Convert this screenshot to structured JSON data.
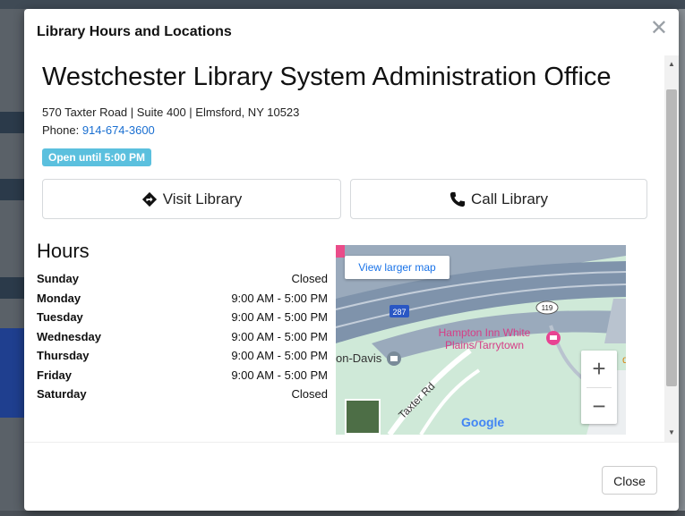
{
  "modal": {
    "title": "Library Hours and Locations",
    "close_icon": "close-icon",
    "office_name": "Westchester Library System Administration Office",
    "address": "570 Taxter Road | Suite 400 | Elmsford, NY 10523",
    "phone_label": "Phone:",
    "phone_number": "914-674-3600",
    "status_badge": "Open until 5:00 PM",
    "visit_label": "Visit Library",
    "visit_icon": "directions-icon",
    "call_label": "Call Library",
    "call_icon": "phone-icon",
    "hours_heading": "Hours",
    "hours": [
      {
        "day": "Sunday",
        "time": "Closed"
      },
      {
        "day": "Monday",
        "time": "9:00 AM - 5:00 PM"
      },
      {
        "day": "Tuesday",
        "time": "9:00 AM - 5:00 PM"
      },
      {
        "day": "Wednesday",
        "time": "9:00 AM - 5:00 PM"
      },
      {
        "day": "Thursday",
        "time": "9:00 AM - 5:00 PM"
      },
      {
        "day": "Friday",
        "time": "9:00 AM - 5:00 PM"
      },
      {
        "day": "Saturday",
        "time": "Closed"
      }
    ],
    "footer_close": "Close"
  },
  "map": {
    "view_larger": "View larger map",
    "label_hampton_1": "Hampton Inn White",
    "label_hampton_2": "Plains/Tarrytown",
    "label_davis": "on-Davis",
    "label_taxter": "Taxter Rd",
    "shield_287": "287",
    "shield_119": "119",
    "google_logo": "Google",
    "zoom_in": "+",
    "zoom_out": "−"
  },
  "colors": {
    "badge": "#5bc0de",
    "link": "#1a6fd1",
    "map_highway": "#7f93ab",
    "map_park": "#cfe9d8"
  }
}
